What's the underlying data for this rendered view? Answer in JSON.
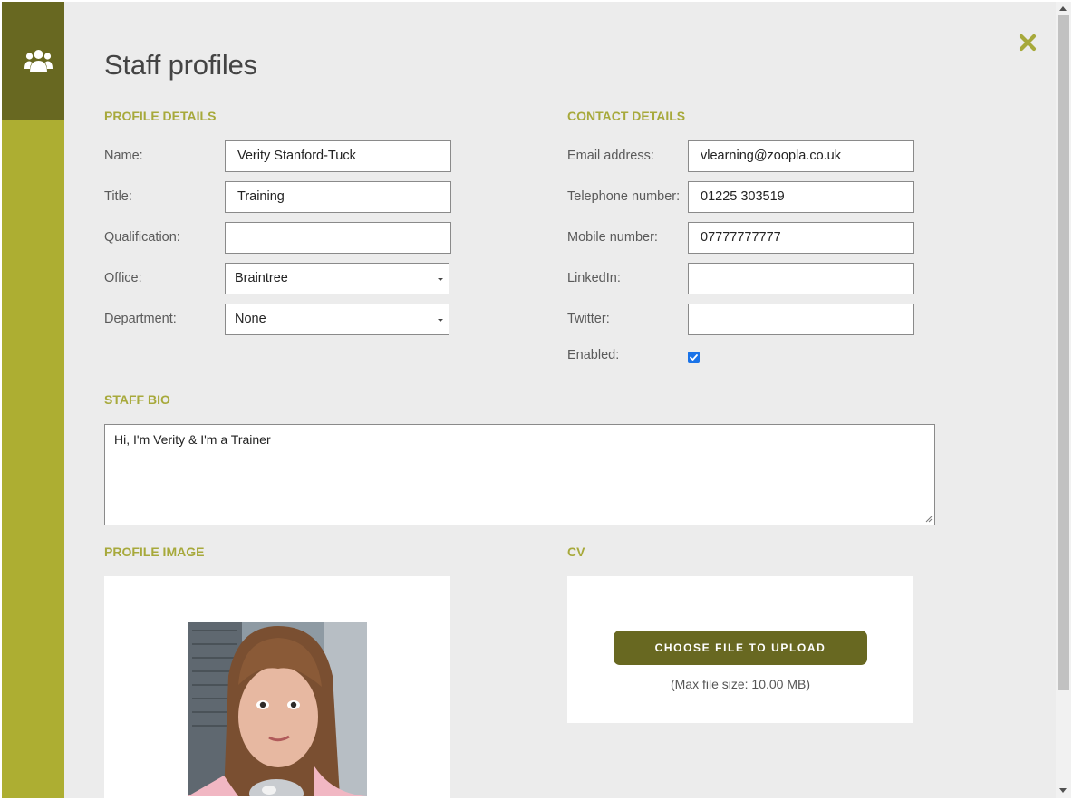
{
  "page": {
    "title": "Staff profiles"
  },
  "colors": {
    "accent": "#adae32",
    "accent_dark": "#686821",
    "background": "#ececec"
  },
  "icons": {
    "sidebar": "users-icon",
    "close": "close-icon"
  },
  "profile": {
    "section_title": "PROFILE DETAILS",
    "name": {
      "label": "Name:",
      "value": "Verity Stanford-Tuck"
    },
    "title": {
      "label": "Title:",
      "value": "Training"
    },
    "qualification": {
      "label": "Qualification:",
      "value": ""
    },
    "office": {
      "label": "Office:",
      "value": "Braintree"
    },
    "department": {
      "label": "Department:",
      "value": "None"
    }
  },
  "contact": {
    "section_title": "CONTACT DETAILS",
    "email": {
      "label": "Email address:",
      "value": "vlearning@zoopla.co.uk"
    },
    "telephone": {
      "label": "Telephone number:",
      "value": "01225 303519"
    },
    "mobile": {
      "label": "Mobile number:",
      "value": "07777777777"
    },
    "linkedin": {
      "label": "LinkedIn:",
      "value": ""
    },
    "twitter": {
      "label": "Twitter:",
      "value": ""
    },
    "enabled": {
      "label": "Enabled:",
      "checked": true
    }
  },
  "bio": {
    "section_title": "STAFF BIO",
    "value": "Hi, I'm Verity & I'm a Trainer"
  },
  "profile_image": {
    "section_title": "PROFILE IMAGE"
  },
  "cv": {
    "section_title": "CV",
    "upload_label": "CHOOSE FILE TO UPLOAD",
    "max_size": "(Max file size: 10.00 MB)"
  }
}
